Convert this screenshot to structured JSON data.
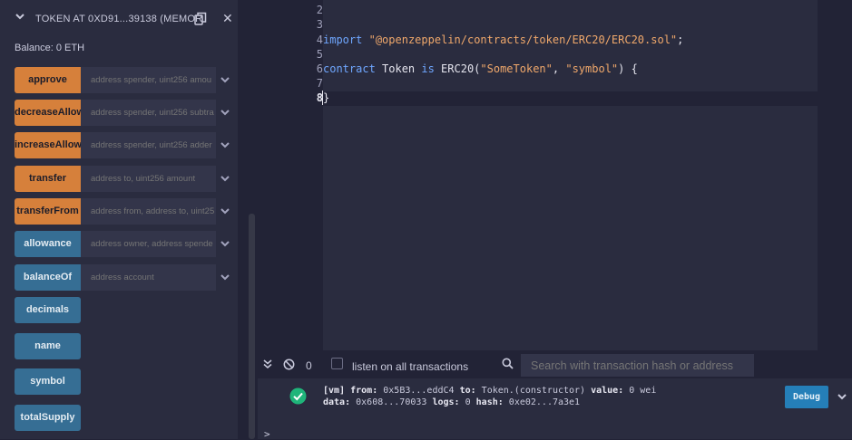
{
  "contract_panel": {
    "title": "TOKEN AT 0XD91...39138 (MEMOR",
    "balance": "Balance: 0 ETH",
    "functions": [
      {
        "label": "approve",
        "placeholder": "address spender, uint256 amou"
      },
      {
        "label": "decreaseAllow",
        "placeholder": "address spender, uint256 subtra"
      },
      {
        "label": "increaseAllow",
        "placeholder": "address spender, uint256 adder"
      },
      {
        "label": "transfer",
        "placeholder": "address to, uint256 amount"
      },
      {
        "label": "transferFrom",
        "placeholder": "address from, address to, uint25"
      },
      {
        "label": "allowance",
        "placeholder": "address owner, address spende"
      },
      {
        "label": "balanceOf",
        "placeholder": "address account"
      },
      {
        "label": "decimals"
      },
      {
        "label": "name"
      },
      {
        "label": "symbol"
      },
      {
        "label": "totalSupply"
      }
    ]
  },
  "editor": {
    "line_numbers": [
      "2",
      "3",
      "4",
      "5",
      "6",
      "7",
      "8"
    ],
    "active_line": "8",
    "lines": {
      "l4_kw": "import",
      "l4_str": "\"@openzeppelin/contracts/token/ERC20/ERC20.sol\"",
      "l4_end": ";",
      "l6_kw1": "contract",
      "l6_name": " Token ",
      "l6_kw2": "is",
      "l6_mid": " ERC20(",
      "l6_str1": "\"SomeToken\"",
      "l6_comma": ", ",
      "l6_str2": "\"symbol\"",
      "l6_end": ") {",
      "l8": "}"
    }
  },
  "terminal_bar": {
    "pending_count": "0",
    "listen_label": "listen on all transactions",
    "search_placeholder": "Search with transaction hash or address"
  },
  "terminal": {
    "log_line1": {
      "tag": "[vm]",
      "from_label": "from:",
      "from": "0x5B3...eddC4",
      "to_label": "to:",
      "to": "Token.(constructor)",
      "value_label": "value:",
      "value": "0 wei"
    },
    "log_line2": {
      "data_label": "data:",
      "data": "0x608...70033",
      "logs_label": "logs:",
      "logs": "0",
      "hash_label": "hash:",
      "hash": "0xe02...7a3e1"
    },
    "debug_label": "Debug",
    "prompt": ">"
  },
  "colors": {
    "orange": "#d6803b",
    "blue": "#366e94",
    "success": "#1fb57a",
    "debug": "#257fb8"
  }
}
